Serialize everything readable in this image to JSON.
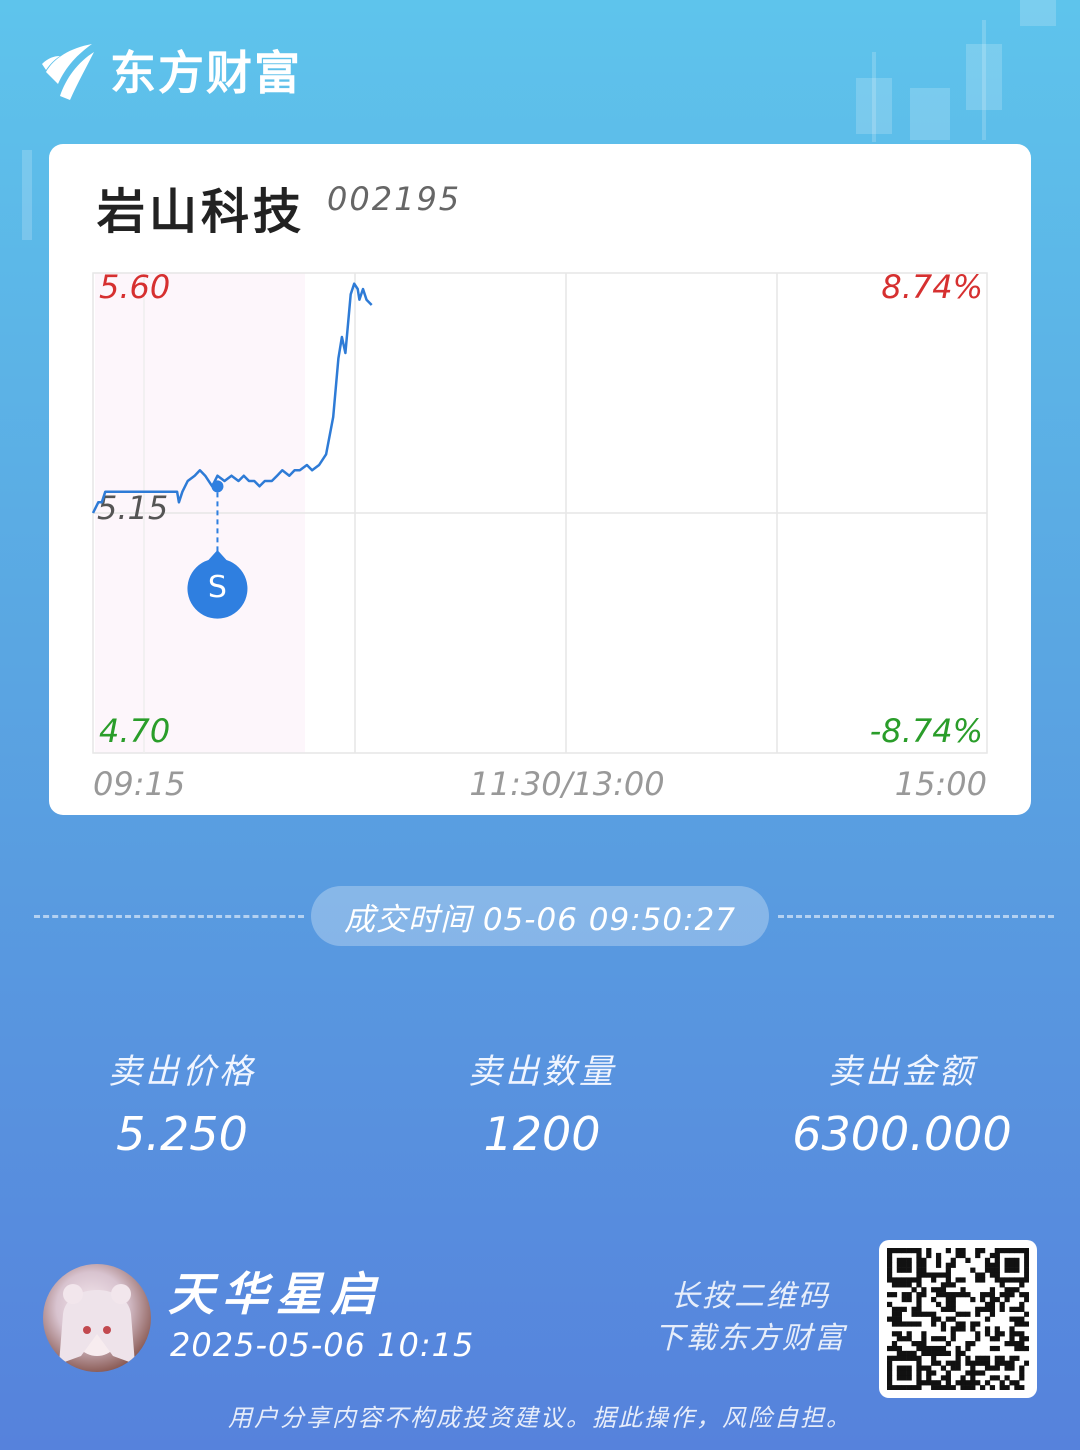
{
  "app": {
    "brand_name": "东方财富"
  },
  "stock": {
    "name": "岩山科技",
    "code": "002195"
  },
  "chart_data": {
    "type": "line",
    "y_labels": {
      "top": "5.60",
      "mid": "5.15",
      "bottom": "4.70"
    },
    "pct_labels": {
      "top": "8.74%",
      "bottom": "-8.74%"
    },
    "x_labels": [
      "09:15",
      "11:30/13:00",
      "15:00"
    ],
    "ylim": [
      4.7,
      5.6
    ],
    "x_range_minutes": [
      0,
      255
    ],
    "series": [
      {
        "points": [
          [
            0,
            5.15
          ],
          [
            1.5,
            5.17
          ],
          [
            2.5,
            5.17
          ],
          [
            3.5,
            5.19
          ],
          [
            4.5,
            5.19
          ],
          [
            15,
            5.19
          ],
          [
            24,
            5.19
          ],
          [
            24.5,
            5.17
          ],
          [
            25.5,
            5.19
          ],
          [
            27,
            5.21
          ],
          [
            29,
            5.22
          ],
          [
            30.5,
            5.23
          ],
          [
            32,
            5.22
          ],
          [
            34,
            5.2
          ],
          [
            35.5,
            5.22
          ],
          [
            37.5,
            5.21
          ],
          [
            39.5,
            5.22
          ],
          [
            41.5,
            5.21
          ],
          [
            43,
            5.22
          ],
          [
            44.5,
            5.21
          ],
          [
            46,
            5.21
          ],
          [
            47.5,
            5.2
          ],
          [
            49,
            5.21
          ],
          [
            51,
            5.21
          ],
          [
            52.5,
            5.22
          ],
          [
            54,
            5.23
          ],
          [
            56,
            5.22
          ],
          [
            57.5,
            5.23
          ],
          [
            59,
            5.23
          ],
          [
            61,
            5.24
          ],
          [
            62.5,
            5.23
          ],
          [
            64.5,
            5.24
          ],
          [
            66.5,
            5.26
          ],
          [
            68.5,
            5.33
          ],
          [
            70,
            5.44
          ],
          [
            71,
            5.48
          ],
          [
            72,
            5.45
          ],
          [
            73.5,
            5.56
          ],
          [
            74.5,
            5.58
          ],
          [
            75.5,
            5.57
          ],
          [
            76,
            5.55
          ],
          [
            77,
            5.57
          ],
          [
            78,
            5.55
          ],
          [
            79.5,
            5.54
          ]
        ]
      }
    ],
    "marker": {
      "label": "S",
      "time_minute": 35.5,
      "price": 5.2
    }
  },
  "trade": {
    "time_text": "成交时间 05-06 09:50:27"
  },
  "stats": [
    {
      "label": "卖出价格",
      "value": "5.250"
    },
    {
      "label": "卖出数量",
      "value": "1200"
    },
    {
      "label": "卖出金额",
      "value": "6300.000"
    }
  ],
  "user": {
    "name": "天华星启",
    "time": "2025-05-06 10:15"
  },
  "qr": {
    "hint_line1": "长按二维码",
    "hint_line2": "下载东方财富"
  },
  "disclaimer": "用户分享内容不构成投资建议。据此操作，风险自担。",
  "colors": {
    "up": "#d63030",
    "down": "#2a9d2a",
    "line": "#2e7bd6",
    "marker": "#2f7fe0"
  }
}
